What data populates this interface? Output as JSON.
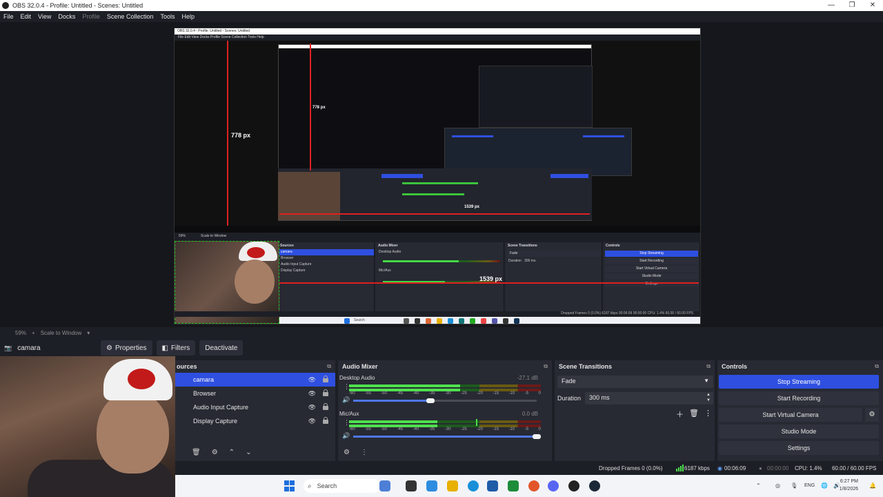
{
  "window": {
    "title": "OBS 32.0.4 - Profile: Untitled - Scenes: Untitled",
    "min": "—",
    "max": "❐",
    "close": "✕"
  },
  "menu": [
    "File",
    "Edit",
    "View",
    "Docks",
    "Profile",
    "Scene Collection",
    "Tools",
    "Help"
  ],
  "preview": {
    "nested_title": "OBS 32.0.4 - Profile: Untitled - Scenes: Untitled",
    "nested_menu": "File   Edit   View   Docks   Profile   Scene Collection   Tools   Help",
    "height_label": "778 px",
    "inner_height_label": "778 px",
    "width_label": "1539 px",
    "inner_width_label": "1539 px",
    "nested_toolbar": {
      "zoom": "59%",
      "scale": "Scale to Window",
      "source": "camara",
      "properties": "Properties",
      "filters": "Filters",
      "deactivate": "Deactivate"
    },
    "nested_docks": {
      "sources_title": "Sources",
      "sources": [
        "camara",
        "Browser",
        "Audio Input Capture",
        "Display Capture"
      ],
      "mixer_title": "Audio Mixer",
      "mixer_ch1": "Desktop Audio",
      "mixer_ch1_db": "-27.1 dB",
      "mixer_ch2": "Mic/Aux",
      "trans_title": "Scene Transitions",
      "trans_fade": "Fade",
      "trans_duration": "Duration",
      "trans_ms": "300 ms",
      "controls_title": "Controls",
      "controls": [
        "Stop Streaming",
        "Start Recording",
        "Start Virtual Camera",
        "Studio Mode",
        "Settings"
      ]
    },
    "nested_status": "Dropped Frames 0 (0.0%)   6187 kbps   00:06:09   00:00:00   CPU: 1.4%   60.00 / 60.00 FPS",
    "nested_search": "Search"
  },
  "preview_footer": {
    "zoom": "59%",
    "plus": "+",
    "scale": "Scale to Window"
  },
  "source_toolbar": {
    "source_name": "camara",
    "properties": "Properties",
    "filters": "Filters",
    "deactivate": "Deactivate"
  },
  "sources_dock": {
    "title": "ources",
    "items": [
      {
        "name": "camara",
        "selected": true
      },
      {
        "name": "Browser",
        "selected": false
      },
      {
        "name": "Audio Input Capture",
        "selected": false
      },
      {
        "name": "Display Capture",
        "selected": false
      }
    ]
  },
  "audio_mixer": {
    "title": "Audio Mixer",
    "scale_ticks": [
      "-60",
      "-55",
      "-50",
      "-45",
      "-40",
      "-35",
      "-30",
      "-25",
      "-20",
      "-15",
      "-10",
      "-5",
      "0"
    ],
    "channels": [
      {
        "name": "Desktop Audio",
        "db": "-27.1 dB",
        "meter_level": 0.58,
        "volume": 0.42
      },
      {
        "name": "Mic/Aux",
        "db": "0.0 dB",
        "meter_level": 0.46,
        "volume": 1.0
      }
    ]
  },
  "scene_transitions": {
    "title": "Scene Transitions",
    "transition": "Fade",
    "duration_label": "Duration",
    "duration_value": "300 ms"
  },
  "controls": {
    "title": "Controls",
    "stop_streaming": "Stop Streaming",
    "start_recording": "Start Recording",
    "start_virtual_camera": "Start Virtual Camera",
    "studio_mode": "Studio Mode",
    "settings": "Settings"
  },
  "status": {
    "dropped_frames": "Dropped Frames 0 (0.0%)",
    "kbps": "6187 kbps",
    "stream_time": "00:06:09",
    "rec_time": "00:00:00",
    "cpu": "CPU: 1.4%",
    "fps": "60.00 / 60.00 FPS"
  },
  "taskbar": {
    "search": "Search",
    "lang": "ENG",
    "time": "6:27 PM",
    "date": "1/8/2026"
  },
  "colors": {
    "accent": "#2e4fe0",
    "background": "#1d1f26",
    "panel": "#272a33",
    "meter_green": "#4ee04e"
  }
}
